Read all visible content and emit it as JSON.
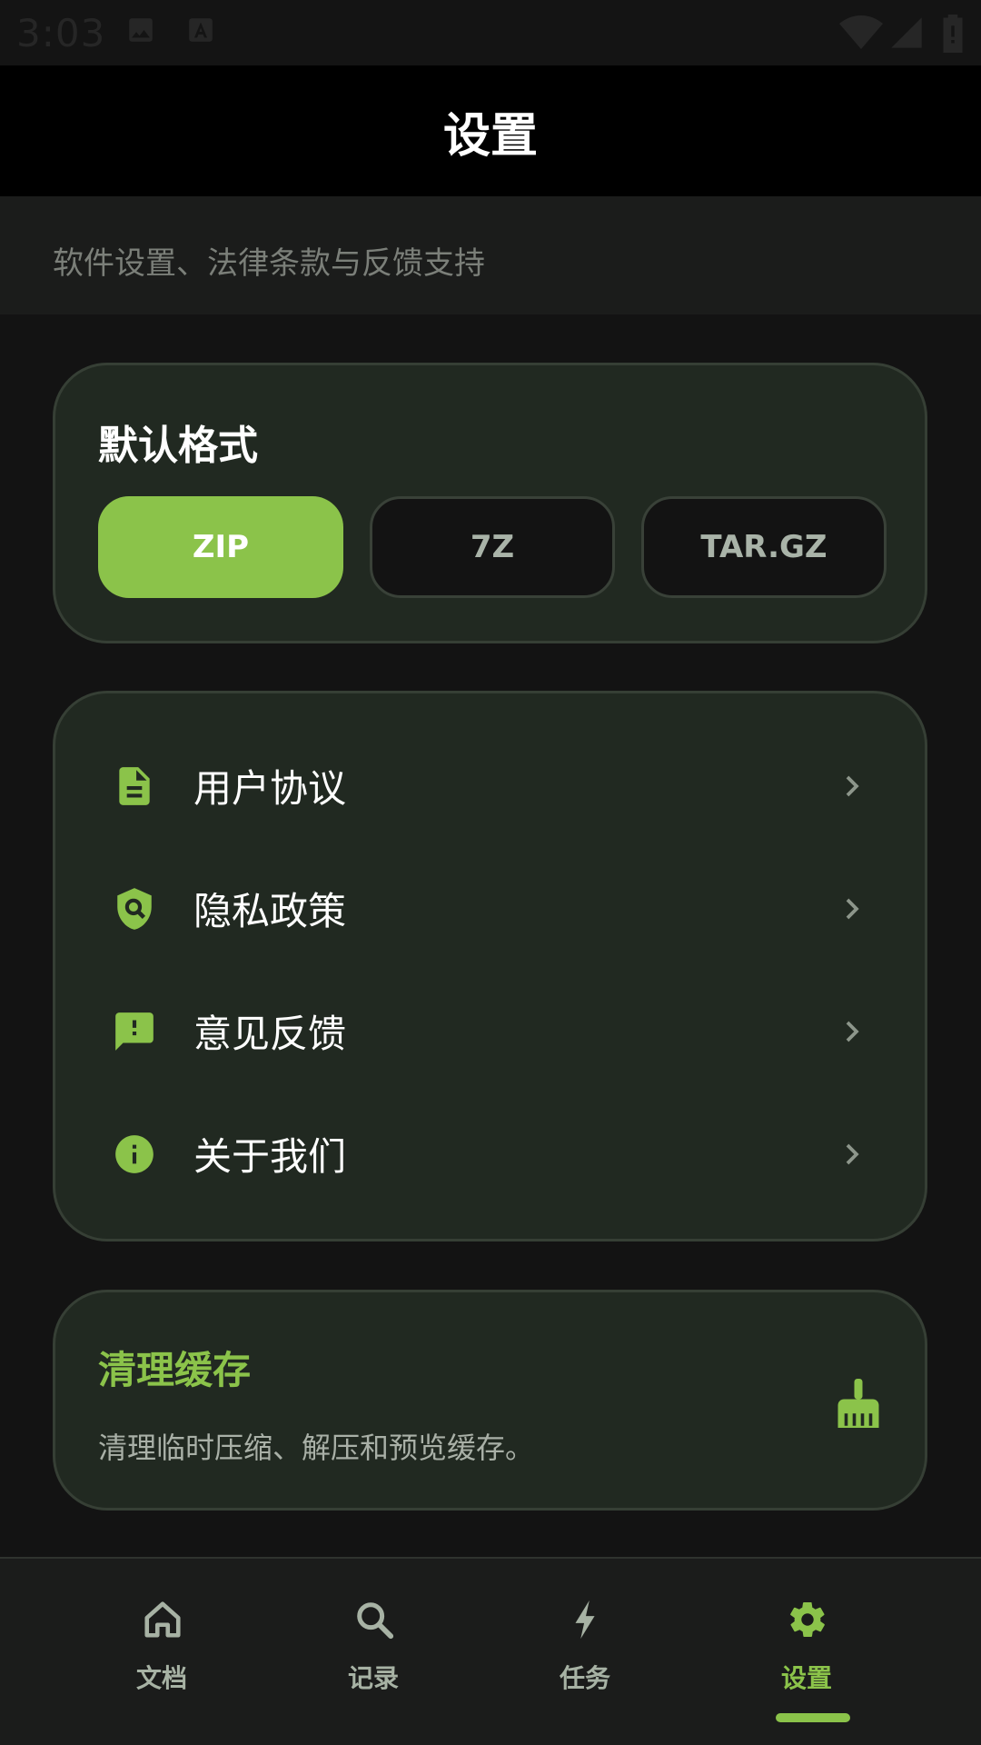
{
  "status_bar": {
    "time": "3:03"
  },
  "app_bar": {
    "title": "设置"
  },
  "subtitle": "软件设置、法律条款与反馈支持",
  "default_format": {
    "heading": "默认格式",
    "options": [
      "ZIP",
      "7Z",
      "TAR.GZ"
    ],
    "selected": "ZIP"
  },
  "links": [
    {
      "label": "用户协议",
      "icon": "document-icon"
    },
    {
      "label": "隐私政策",
      "icon": "shield-search-icon"
    },
    {
      "label": "意见反馈",
      "icon": "feedback-icon"
    },
    {
      "label": "关于我们",
      "icon": "info-icon"
    }
  ],
  "cache": {
    "title": "清理缓存",
    "description": "清理临时压缩、解压和预览缓存。",
    "icon": "broom-icon"
  },
  "bottom_nav": {
    "items": [
      {
        "label": "文档",
        "icon": "home-icon"
      },
      {
        "label": "记录",
        "icon": "search-icon"
      },
      {
        "label": "任务",
        "icon": "bolt-icon"
      },
      {
        "label": "设置",
        "icon": "gear-icon"
      }
    ],
    "active": "设置"
  },
  "colors": {
    "accent": "#8bc34a",
    "background": "#131313",
    "card": "#212921",
    "card_border": "#363f35",
    "app_bar": "#000000"
  }
}
